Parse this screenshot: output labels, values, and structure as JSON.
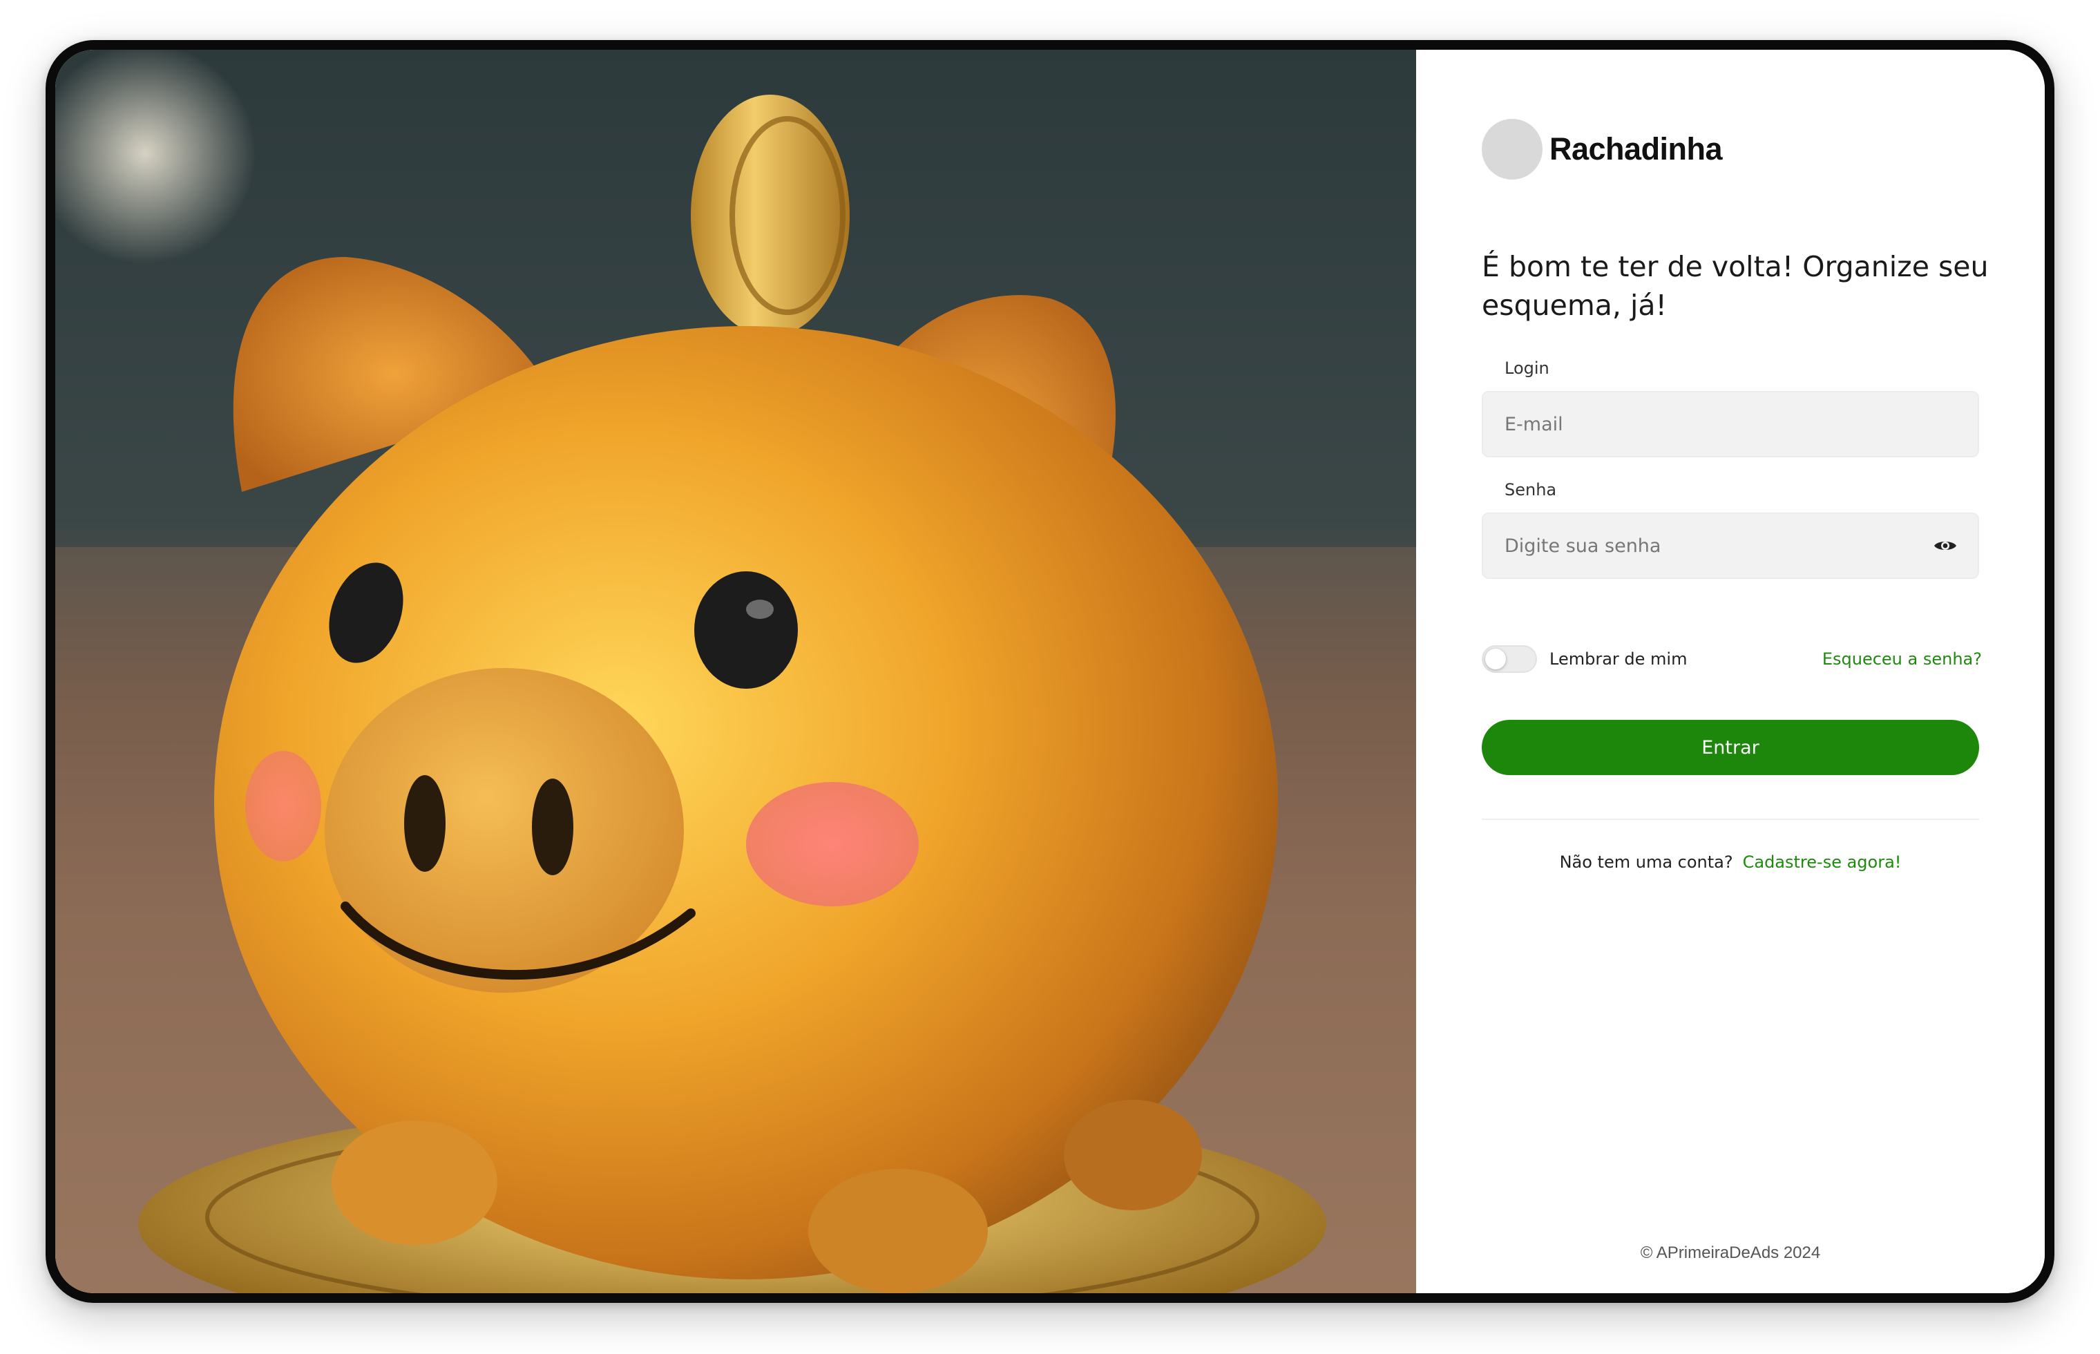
{
  "brand": {
    "name": "Rachadinha"
  },
  "hero": {
    "image": "golden-piggy-bank-photo"
  },
  "login": {
    "headline": "É bom te ter de volta! Organize seu esquema, já!",
    "email_label": "Login",
    "email_placeholder": "E-mail",
    "password_label": "Senha",
    "password_placeholder": "Digite sua senha",
    "password_toggle_icon": "eye-icon",
    "remember_label": "Lembrar de mim",
    "remember_checked": false,
    "forgot_link": "Esqueceu a senha?",
    "submit_label": "Entrar"
  },
  "signup": {
    "prompt": "Não tem uma conta?",
    "link": "Cadastre-se agora!"
  },
  "footer": {
    "copyright": "© APrimeiraDeAds 2024"
  },
  "colors": {
    "accent": "#1d870b",
    "link": "#1e8a0e",
    "input_bg": "#f2f2f2"
  }
}
